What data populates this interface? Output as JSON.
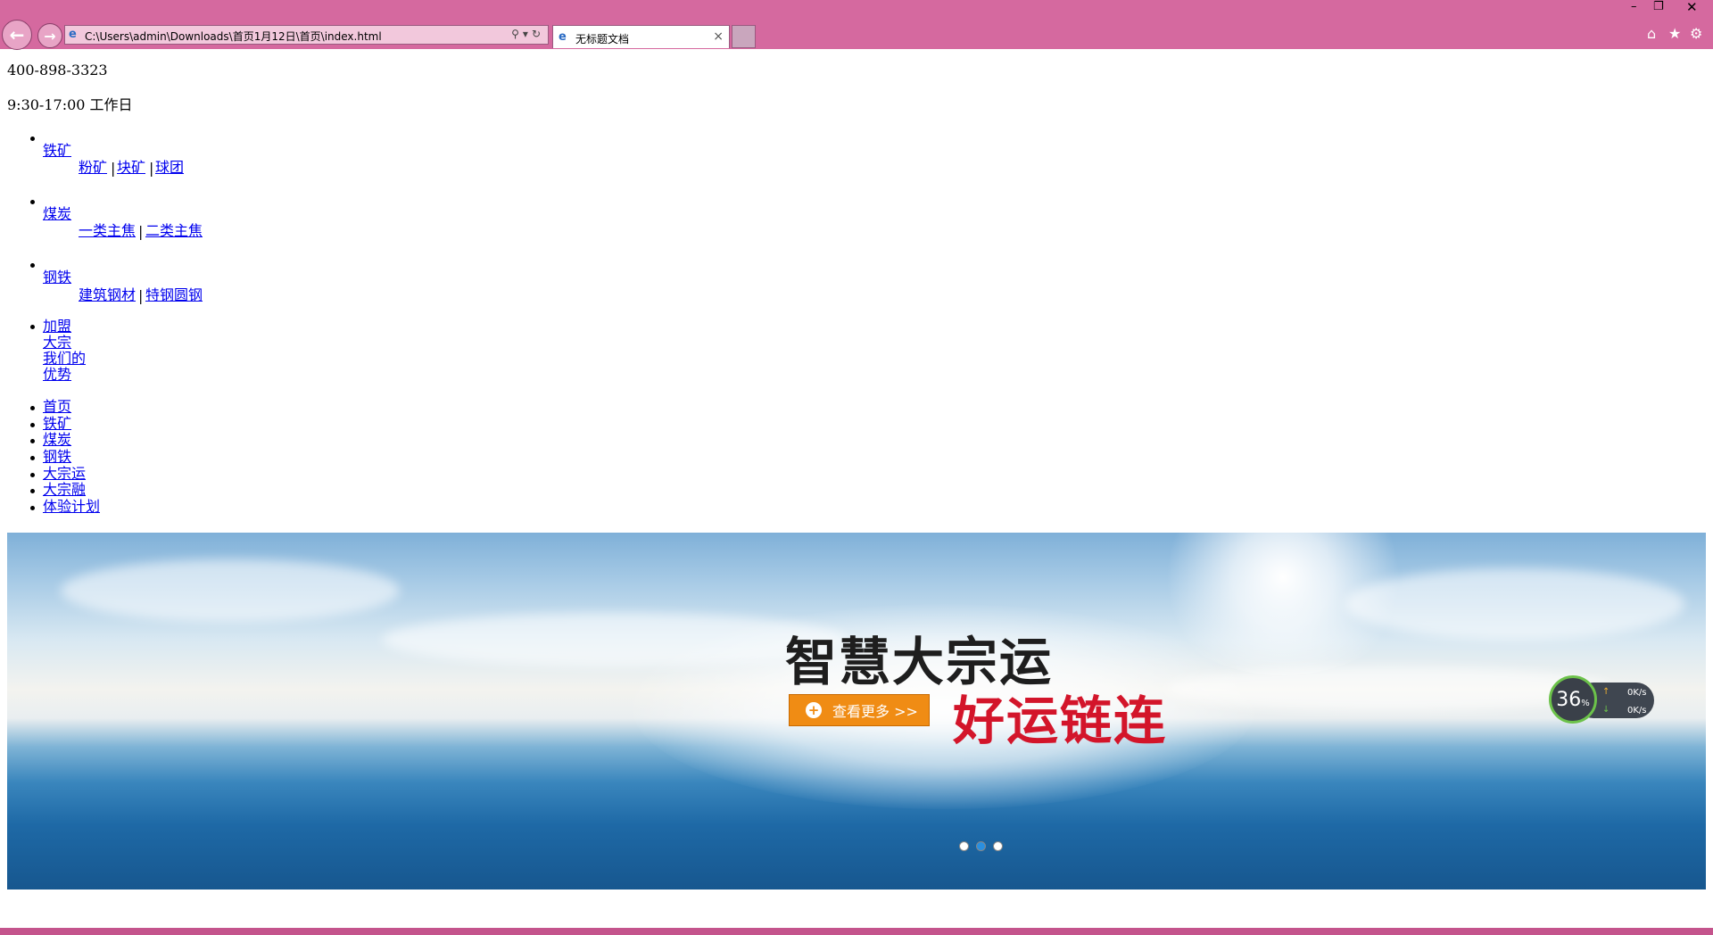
{
  "browser": {
    "url": "C:\\Users\\admin\\Downloads\\首页1月12日\\首页\\index.html",
    "tab_title": "无标题文档",
    "back_icon": "back-arrow-icon",
    "forward_icon": "forward-arrow-icon"
  },
  "header": {
    "phone": "400-898-3323",
    "hours": "9:30-17:00 工作日"
  },
  "menu": [
    {
      "label": "铁矿",
      "sub": [
        "粉矿",
        "块矿",
        "球团"
      ]
    },
    {
      "label": "煤炭",
      "sub": [
        "一类主焦",
        "二类主焦"
      ]
    },
    {
      "label": "钢铁",
      "sub": [
        "建筑钢材",
        "特钢圆钢"
      ]
    }
  ],
  "join": [
    "加盟",
    "大宗",
    "我们的",
    "优势"
  ],
  "nav": [
    "首页",
    "铁矿",
    "煤炭",
    "钢铁",
    "大宗运",
    "大宗融",
    "体验计划"
  ],
  "banner": {
    "slogan_main": "智慧大宗运",
    "slogan_sub": "好运链连",
    "more_label": "查看更多 >>"
  },
  "speed_widget": {
    "percent": "36",
    "percent_unit": "%",
    "up_rate": "0K/s",
    "down_rate": "0K/s"
  },
  "colors": {
    "chrome": "#d5699f",
    "link": "#0000ee",
    "button": "#f08c14",
    "slogan_red": "#d3152a"
  }
}
